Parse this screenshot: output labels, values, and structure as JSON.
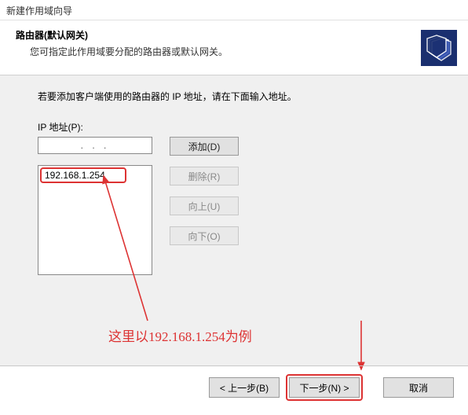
{
  "window": {
    "title": "新建作用域向导"
  },
  "header": {
    "title": "路由器(默认网关)",
    "subtitle": "您可指定此作用域要分配的路由器或默认网关。"
  },
  "content": {
    "instruction": "若要添加客户端使用的路由器的 IP 地址，请在下面输入地址。",
    "ip_label": "IP 地址(P):",
    "ip_input_value": ".    .    .",
    "listed_ip": "192.168.1.254"
  },
  "buttons": {
    "add": "添加(D)",
    "remove": "删除(R)",
    "up": "向上(U)",
    "down": "向下(O)",
    "back": "< 上一步(B)",
    "next": "下一步(N) >",
    "cancel": "取消"
  },
  "annotation": {
    "text": "这里以192.168.1.254为例"
  }
}
